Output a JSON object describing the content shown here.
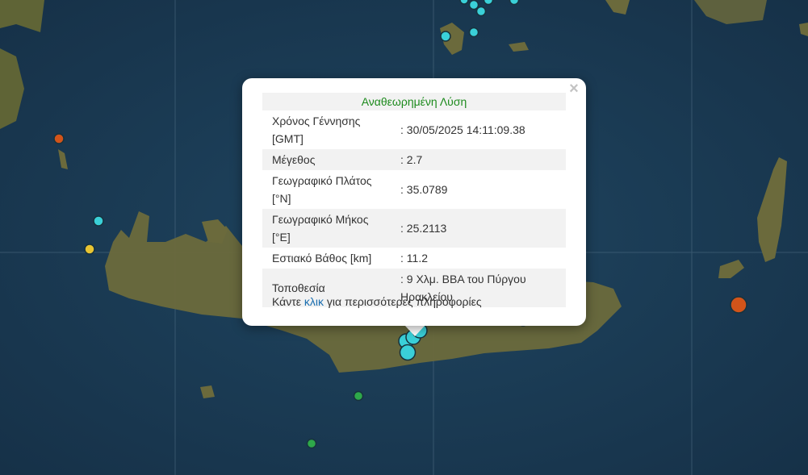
{
  "popup": {
    "close_symbol": "×",
    "heading": "Αναθεωρημένη Λύση",
    "rows": [
      {
        "label": "Χρόνος Γέννησης [GMT]",
        "value": ": 30/05/2025 14:11:09.38"
      },
      {
        "label": "Μέγεθος",
        "value": ": 2.7"
      },
      {
        "label": "Γεωγραφικό Πλάτος [°N]",
        "value": ": 35.0789"
      },
      {
        "label": "Γεωγραφικό Μήκος [°E]",
        "value": ": 25.2113"
      },
      {
        "label": "Εστιακό Βάθος [km]",
        "value": ": 11.2"
      },
      {
        "label": "Τοποθεσία",
        "value": ": 9 Χλμ. ΒΒΑ του Πύργου Ηρακλείου"
      }
    ],
    "more_prefix": "Κάντε ",
    "more_link": "κλικ",
    "more_suffix": " για περισσότερες πληροφορίες"
  },
  "colors": {
    "sea": "#1b3a52",
    "land": "#6b6a3c",
    "marker_cyan": "#3ad0d8",
    "marker_orange": "#d2541a",
    "marker_yellow": "#e8c432",
    "marker_green": "#2ea84a",
    "heading_green": "#1d8a1d",
    "link_blue": "#1a6eb0"
  }
}
